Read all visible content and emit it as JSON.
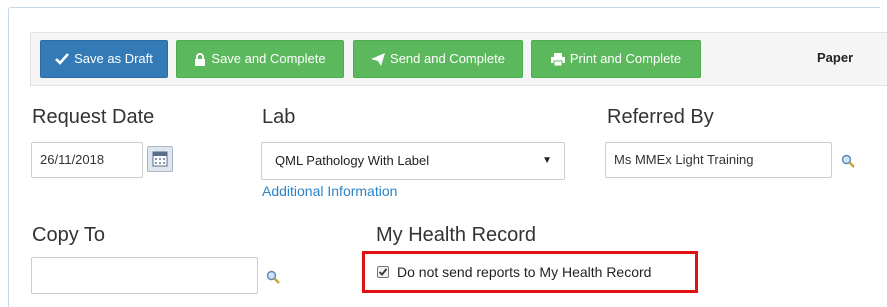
{
  "toolbar": {
    "save_draft_label": "Save as Draft",
    "save_complete_label": "Save and Complete",
    "send_complete_label": "Send and Complete",
    "print_complete_label": "Print and Complete",
    "paper_label": "Paper"
  },
  "form": {
    "request_date": {
      "label": "Request Date",
      "value": "26/11/2018"
    },
    "lab": {
      "label": "Lab",
      "selected": "QML Pathology With Label",
      "link": "Additional Information"
    },
    "referred_by": {
      "label": "Referred By",
      "value": "Ms MMEx Light Training"
    },
    "copy_to": {
      "label": "Copy To",
      "value": ""
    },
    "my_health_record": {
      "label": "My Health Record",
      "checkbox_label": "Do not send reports to My Health Record",
      "checked": true
    }
  },
  "colors": {
    "primary": "#337ab7",
    "success": "#5cb85c",
    "link": "#2a83c6",
    "highlight": "#e01010"
  },
  "icons": [
    "check-icon",
    "lock-icon",
    "send-icon",
    "print-icon",
    "calendar-icon",
    "search-icon",
    "checkbox-checked-icon",
    "dropdown-caret-icon"
  ]
}
